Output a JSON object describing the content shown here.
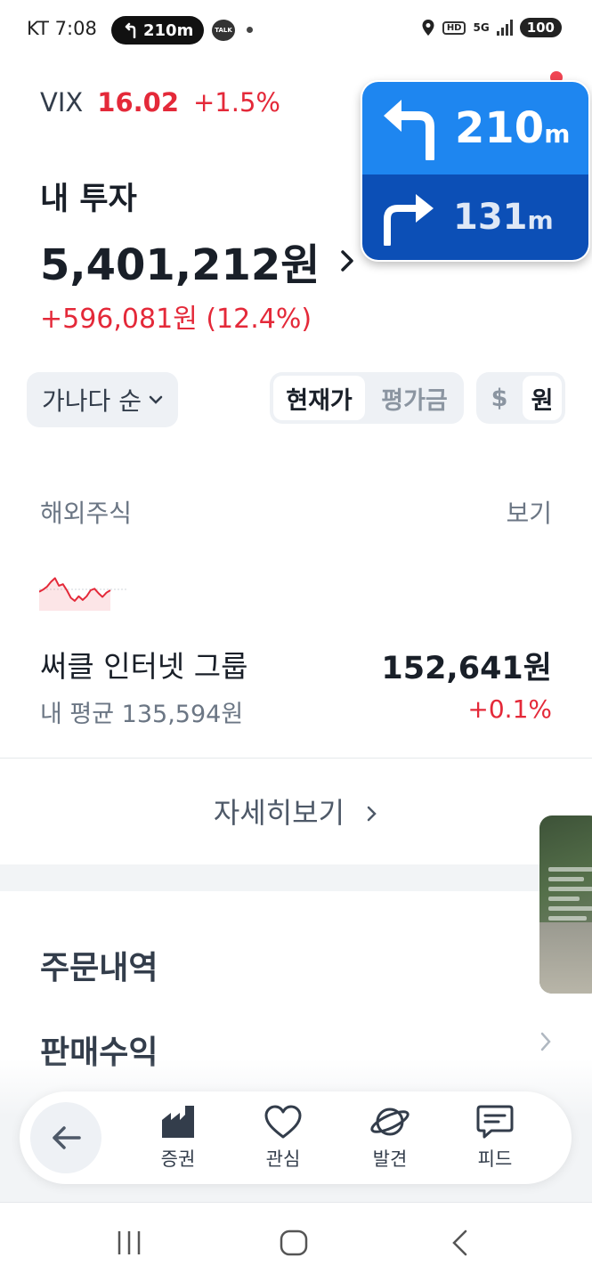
{
  "status_bar": {
    "carrier_time": "KT 7:08",
    "nav_pill": "210m",
    "talk_icon_text": "TALK",
    "hd": "HD",
    "network": "5G",
    "battery": "100"
  },
  "vix": {
    "label": "VIX",
    "value": "16.02",
    "change": "+1.5%"
  },
  "investment": {
    "title": "내 투자",
    "total": "5,401,212원",
    "gain": "+596,081원 (12.4%)"
  },
  "navigation_widget": {
    "next_distance": "210",
    "next_unit": "m",
    "then_distance": "131",
    "then_unit": "m"
  },
  "filters": {
    "sort": "가나다 순",
    "price_toggle": [
      "현재가",
      "평가금"
    ],
    "price_toggle_selected": 0,
    "currency_toggle": [
      "$",
      "원"
    ],
    "currency_toggle_selected": 1
  },
  "section": {
    "title": "해외주식",
    "view": "보기"
  },
  "holding": {
    "name": "써클 인터넷 그룹",
    "price": "152,641원",
    "avg": "내 평균 135,594원",
    "change": "+0.1%",
    "sparkline": [
      0.45,
      0.52,
      0.62,
      0.78,
      0.9,
      0.65,
      0.7,
      0.5,
      0.25,
      0.15,
      0.3,
      0.18,
      0.3,
      0.5,
      0.55,
      0.4,
      0.28,
      0.42,
      0.5
    ]
  },
  "more_label": "자세히보기",
  "menu": {
    "orders": "주문내역",
    "sales": "판매수익"
  },
  "tabbar": {
    "items": [
      {
        "label": "증권",
        "icon": "chart-building-icon"
      },
      {
        "label": "관심",
        "icon": "heart-icon"
      },
      {
        "label": "발견",
        "icon": "planet-icon"
      },
      {
        "label": "피드",
        "icon": "chat-bubble-icon"
      }
    ]
  },
  "colors": {
    "up_red": "#e42939",
    "nav_blue_light": "#1e86f0",
    "nav_blue_dark": "#0c4fb6",
    "text_primary": "#191f28",
    "text_secondary": "#6b7684"
  }
}
